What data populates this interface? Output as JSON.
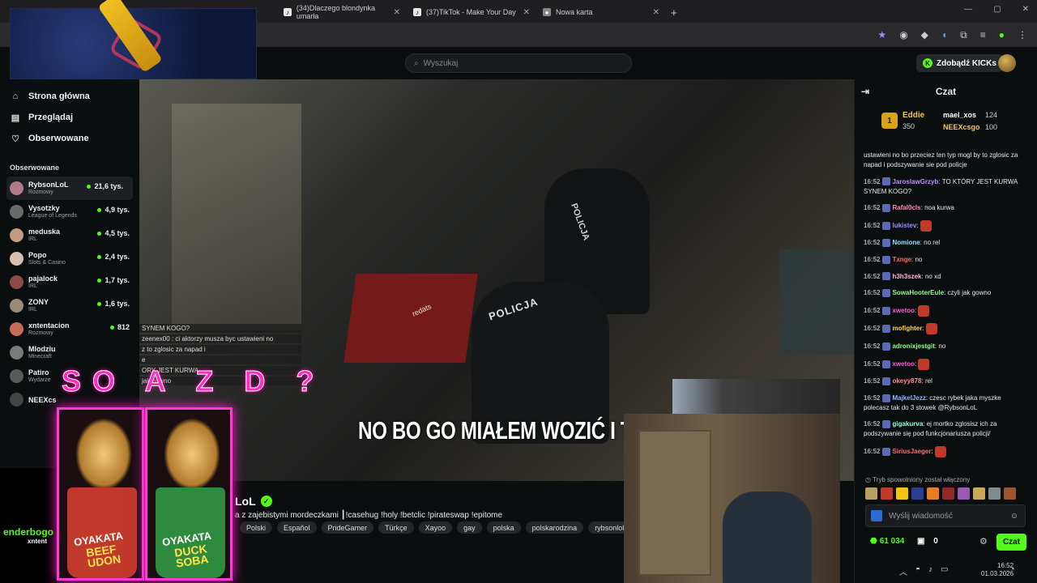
{
  "browser": {
    "tabs": [
      {
        "label": "(34)Dlaczego blondynka umarła",
        "fav": "♪"
      },
      {
        "label": "(37)TikTok - Make Your Day",
        "fav": "♪"
      },
      {
        "label": "Nowa karta",
        "fav": "●"
      }
    ],
    "new_tab": "+"
  },
  "topbar": {
    "search_placeholder": "Wyszukaj",
    "kicks_button": "Zdobądź KICKs"
  },
  "sidebar": {
    "nav": [
      {
        "label": "Strona główna",
        "icon": "home-icon"
      },
      {
        "label": "Przeglądaj",
        "icon": "browse-icon"
      },
      {
        "label": "Obserwowane",
        "icon": "heart-icon"
      }
    ],
    "followed_heading": "Obserwowane",
    "channels": [
      {
        "name": "RybsonLoL",
        "category": "Rozmowy",
        "viewers": "21,6 tys.",
        "color": "#b07a8a"
      },
      {
        "name": "Vysotzky",
        "category": "League of Legends",
        "viewers": "4,9 tys.",
        "color": "#6a6a6a"
      },
      {
        "name": "meduska",
        "category": "IRL",
        "viewers": "4,5 tys.",
        "color": "#c49a82"
      },
      {
        "name": "Popo",
        "category": "Slots & Casino",
        "viewers": "2,4 tys.",
        "color": "#d7c0b0"
      },
      {
        "name": "pajalock",
        "category": "IRL",
        "viewers": "1,7 tys.",
        "color": "#8a4a4a"
      },
      {
        "name": "ZONY",
        "category": "IRL",
        "viewers": "1,6 tys.",
        "color": "#9a8a7a"
      },
      {
        "name": "xntentacion",
        "category": "Rozmowy",
        "viewers": "812",
        "color": "#c86a5a"
      },
      {
        "name": "Mlodziu",
        "category": "Minecraft",
        "viewers": "",
        "color": "#7a7a7a"
      },
      {
        "name": "Patiro",
        "category": "Wydarze",
        "viewers": "",
        "color": "#5a5a5a"
      },
      {
        "name": "NEEXcs",
        "category": "",
        "viewers": "",
        "color": "#444444"
      }
    ]
  },
  "video": {
    "subtitle": "NO BO GO MIAŁEM WOZIĆ I TYL",
    "scene_text_1": "POLICJA",
    "scene_text_2": "POLICJA",
    "scene_text_3": "redats"
  },
  "overlay": {
    "chat_lines": [
      "SYNEM KOGO?",
      "zeenex00 : ci aktorzy musza byc ustawieni no",
      "z to zglosic za napad i",
      "e",
      "ORY JEST KURWA",
      "jak gowno"
    ],
    "big_text": "SO A Z D ?",
    "promo_brand": "OYAKATA",
    "promo_left": "BEEF UDON",
    "promo_right": "DUCK SOBA",
    "corner_text": "enderbogo",
    "corner_text_2": "xntent"
  },
  "stream": {
    "streamer": "LoL",
    "title": "a z zajebistymi mordeczkami ┃!casehug !holy !betclic !pirateswap !epitome",
    "tags": [
      "Polski",
      "Español",
      "PrideGamer",
      "Türkçe",
      "Xayoo",
      "gay",
      "polska",
      "polskarodzina",
      "rybsonlol"
    ]
  },
  "chat": {
    "title": "Czat",
    "leaderboard": {
      "first": {
        "rank": "1",
        "name": "Eddie",
        "points": "350"
      },
      "second": {
        "name": "mael_xos",
        "points": "124"
      },
      "third": {
        "name": "NEEXcsgo",
        "points": "100"
      }
    },
    "messages": [
      {
        "time": "",
        "user": "",
        "color": "#fff",
        "text": "ustawieni no bo przeciez ten typ mogl by to zglosic za napad i podszywanie sie pod policje"
      },
      {
        "time": "16:52",
        "user": "JaroslawGrzyb",
        "color": "#c58cff",
        "text": "TO KTÓRY JEST KURWA SYNEM KOGO?"
      },
      {
        "time": "16:52",
        "user": "Rafal0cls",
        "color": "#ff8cb5",
        "text": "noa kurwa"
      },
      {
        "time": "16:52",
        "user": "lukistev",
        "color": "#a68cff",
        "text": ""
      },
      {
        "time": "16:52",
        "user": "Nomione",
        "color": "#8ce0ff",
        "text": "no rel"
      },
      {
        "time": "16:52",
        "user": "Txnge",
        "color": "#ff6b6b",
        "text": "no"
      },
      {
        "time": "16:52",
        "user": "h3h3szek",
        "color": "#ffb3d9",
        "text": "no xd"
      },
      {
        "time": "16:52",
        "user": "SowaHooterEule",
        "color": "#8cff8c",
        "text": "czyli jak gowno"
      },
      {
        "time": "16:52",
        "user": "xwetoo",
        "color": "#ff5cd6",
        "text": ""
      },
      {
        "time": "16:52",
        "user": "mofighter",
        "color": "#ffd24d",
        "text": ""
      },
      {
        "time": "16:52",
        "user": "adronixjestgit",
        "color": "#8cff8c",
        "text": "no"
      },
      {
        "time": "16:52",
        "user": "xwetoo",
        "color": "#ff5cd6",
        "text": ""
      },
      {
        "time": "16:52",
        "user": "okeyy878",
        "color": "#ff8c8c",
        "text": "rel"
      },
      {
        "time": "16:52",
        "user": "MajkelJezz",
        "color": "#8cb5ff",
        "text": "czesc rybek jaka myszke polecasz tak do 3 stowek @RybsonLoL"
      },
      {
        "time": "16:52",
        "user": "gigakurva",
        "color": "#8cffd9",
        "text": "ej mortko zglosisz ich za podszywanie się pod funkcjonariusza policji/"
      },
      {
        "time": "16:52",
        "user": "SiriusJaeger",
        "color": "#ff6b6b",
        "text": ""
      }
    ],
    "slowmode": "Tryb spowolniony został włączony",
    "input_placeholder": "Wyślij wiadomość",
    "points": "61 034",
    "chest_count": "0",
    "send_label": "Czat"
  },
  "taskbar": {
    "time": "16:52",
    "date": "01.03.2026"
  }
}
